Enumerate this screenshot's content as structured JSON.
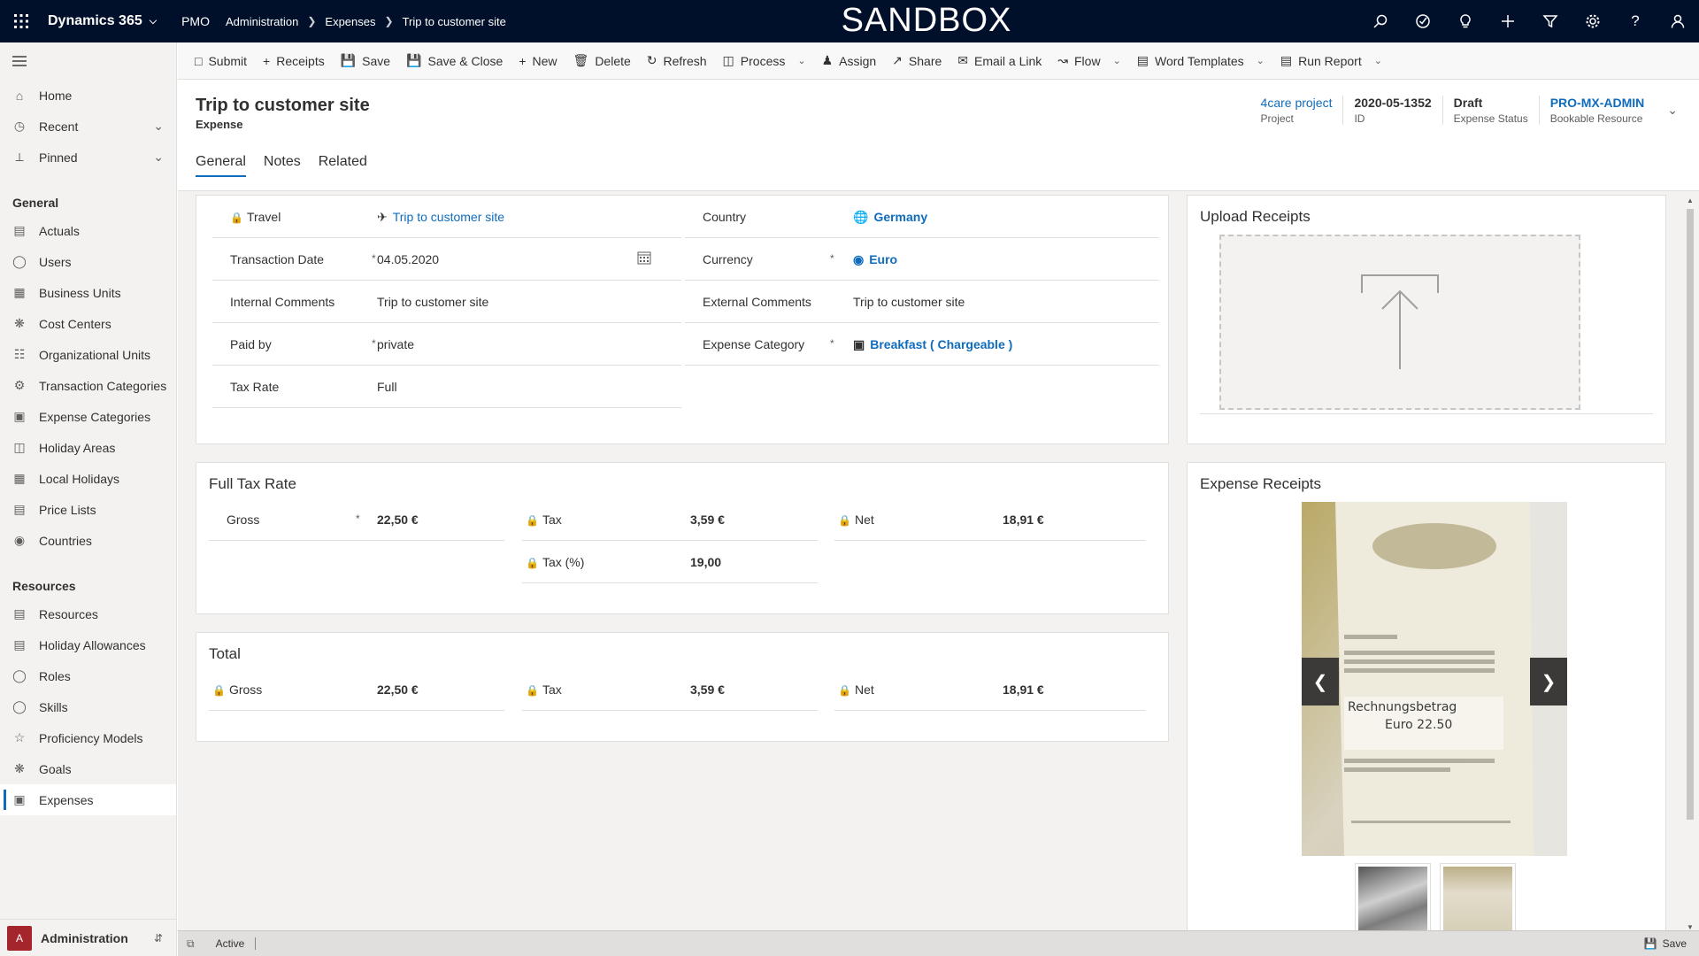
{
  "topbar": {
    "app_name": "Dynamics 365",
    "area": "PMO",
    "breadcrumb": [
      "Administration",
      "Expenses",
      "Trip to customer site"
    ],
    "environment_banner": "SANDBOX",
    "icons": [
      "search-icon",
      "task-icon",
      "lightbulb-icon",
      "plus-icon",
      "filter-icon",
      "gear-icon",
      "help-icon",
      "user-icon"
    ]
  },
  "sidebar": {
    "top_items": [
      {
        "label": "Home",
        "icon": "home-icon"
      },
      {
        "label": "Recent",
        "icon": "clock-icon",
        "chevron": true
      },
      {
        "label": "Pinned",
        "icon": "pin-icon",
        "chevron": true
      }
    ],
    "groups": [
      {
        "title": "General",
        "items": [
          {
            "label": "Actuals"
          },
          {
            "label": "Users"
          },
          {
            "label": "Business Units"
          },
          {
            "label": "Cost Centers"
          },
          {
            "label": "Organizational Units"
          },
          {
            "label": "Transaction Categories"
          },
          {
            "label": "Expense Categories"
          },
          {
            "label": "Holiday Areas"
          },
          {
            "label": "Local Holidays"
          },
          {
            "label": "Price Lists"
          },
          {
            "label": "Countries"
          }
        ]
      },
      {
        "title": "Resources",
        "items": [
          {
            "label": "Resources"
          },
          {
            "label": "Holiday Allowances"
          },
          {
            "label": "Roles"
          },
          {
            "label": "Skills"
          },
          {
            "label": "Proficiency Models"
          },
          {
            "label": "Goals"
          },
          {
            "label": "Expenses",
            "active": true
          }
        ]
      }
    ],
    "area_switcher": {
      "badge": "A",
      "label": "Administration"
    }
  },
  "commands": [
    {
      "label": "Submit",
      "icon": "doc-icon"
    },
    {
      "label": "Receipts",
      "icon": "plus-icon"
    },
    {
      "label": "Save",
      "icon": "save-icon"
    },
    {
      "label": "Save & Close",
      "icon": "save-close-icon"
    },
    {
      "label": "New",
      "icon": "plus-icon"
    },
    {
      "label": "Delete",
      "icon": "trash-icon"
    },
    {
      "label": "Refresh",
      "icon": "refresh-icon"
    },
    {
      "label": "Process",
      "icon": "process-icon",
      "dropdown": true
    },
    {
      "label": "Assign",
      "icon": "assign-icon"
    },
    {
      "label": "Share",
      "icon": "share-icon"
    },
    {
      "label": "Email a Link",
      "icon": "mail-icon"
    },
    {
      "label": "Flow",
      "icon": "flow-icon",
      "dropdown": true
    },
    {
      "label": "Word Templates",
      "icon": "word-icon",
      "dropdown": true
    },
    {
      "label": "Run Report",
      "icon": "report-icon",
      "dropdown": true
    }
  ],
  "record": {
    "title": "Trip to customer site",
    "entity": "Expense",
    "header_fields": [
      {
        "value": "4care project",
        "label": "Project",
        "style": "link"
      },
      {
        "value": "2020-05-1352",
        "label": "ID",
        "style": "bold"
      },
      {
        "value": "Draft",
        "label": "Expense Status",
        "style": "bold"
      },
      {
        "value": "PRO-MX-ADMIN",
        "label": "Bookable Resource",
        "style": "linkb"
      }
    ],
    "tabs": [
      "General",
      "Notes",
      "Related"
    ]
  },
  "general": {
    "left": [
      {
        "label": "Travel",
        "lock": true,
        "value": "Trip to customer site",
        "style": "link",
        "icon": "airplane-icon"
      },
      {
        "label": "Transaction Date",
        "required": true,
        "value": "04.05.2020",
        "style": "plain",
        "calendar": true
      },
      {
        "label": "Internal Comments",
        "value": "Trip to customer site",
        "style": "plain"
      },
      {
        "label": "Paid by",
        "required": true,
        "value": "private",
        "style": "plain"
      },
      {
        "label": "Tax Rate",
        "value": "Full",
        "style": "plain"
      }
    ],
    "right": [
      {
        "label": "Country",
        "value": "Germany",
        "style": "linkb",
        "icon": "globe-icon"
      },
      {
        "label": "Currency",
        "required": true,
        "value": "Euro",
        "style": "linkb",
        "icon": "currency-icon"
      },
      {
        "label": "External Comments",
        "value": "Trip to customer site",
        "style": "plain"
      },
      {
        "label": "Expense Category",
        "required": true,
        "value": "Breakfast ( Chargeable )",
        "style": "linkb",
        "icon": "category-icon"
      }
    ]
  },
  "full_tax_rate": {
    "title": "Full Tax Rate",
    "gross": {
      "label": "Gross",
      "value": "22,50 €"
    },
    "tax": {
      "label": "Tax",
      "value": "3,59 €"
    },
    "net": {
      "label": "Net",
      "value": "18,91 €"
    },
    "tax_pct": {
      "label": "Tax (%)",
      "value": "19,00"
    }
  },
  "total": {
    "title": "Total",
    "gross": {
      "label": "Gross",
      "value": "22,50 €"
    },
    "tax": {
      "label": "Tax",
      "value": "3,59 €"
    },
    "net": {
      "label": "Net",
      "value": "18,91 €"
    }
  },
  "upload_receipts": {
    "title": "Upload Receipts"
  },
  "expense_receipts": {
    "title": "Expense Receipts",
    "receipt_text": [
      "Rechnungsbetrag",
      "Euro 22.50"
    ]
  },
  "footer": {
    "status": "Active",
    "save_label": "Save"
  }
}
